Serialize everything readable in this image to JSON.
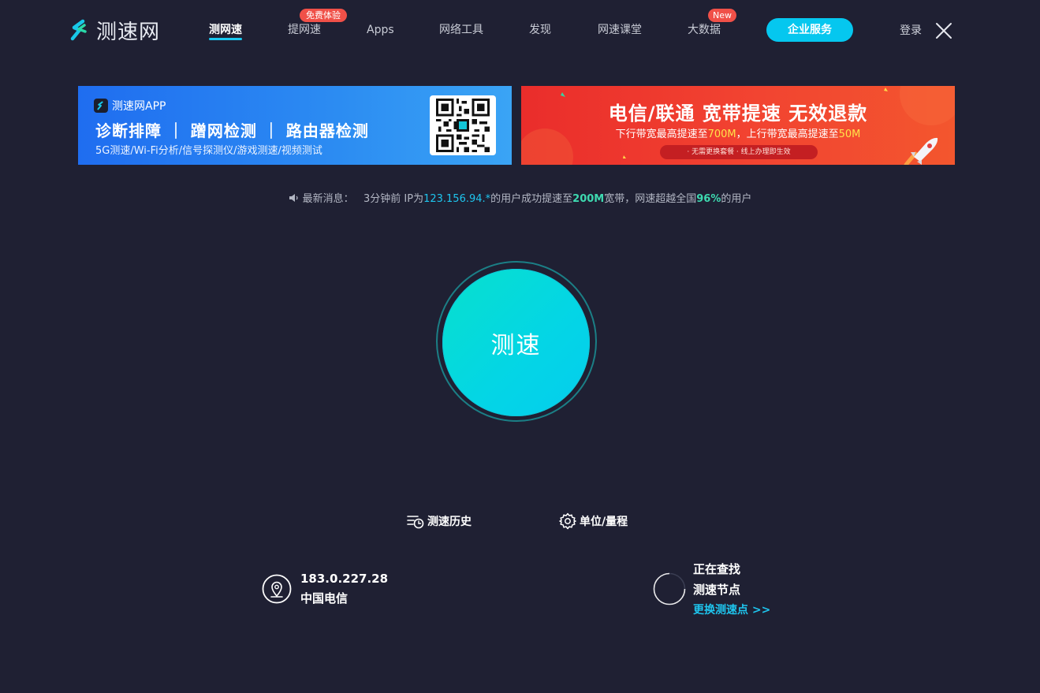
{
  "brand": {
    "name": "测速网",
    "logo_icon": "speedtest-logo-icon"
  },
  "nav": {
    "items": [
      {
        "label": "测网速",
        "active": true
      },
      {
        "label": "提网速",
        "badge": "免费体验"
      },
      {
        "label": "Apps"
      },
      {
        "label": "网络工具"
      },
      {
        "label": "发现"
      },
      {
        "label": "网速课堂"
      },
      {
        "label": "大数据",
        "badge": "New"
      }
    ],
    "enterprise_label": "企业服务",
    "login_label": "登录",
    "close_icon": "close-icon"
  },
  "banners": {
    "app": {
      "app_name": "测速网APP",
      "features": "诊断排障 ｜ 蹭网检测 ｜ 路由器检测",
      "subtitle": "5G测速/Wi-Fi分析/信号探测仪/游戏测速/视频测试",
      "qr_icon": "qr-code-icon"
    },
    "promo": {
      "title": "电信/联通 宽带提速 无效退款",
      "sub_prefix": "下行带宽最高提速至",
      "sub_down": "700M",
      "sub_mid": "，上行带宽最高提速至",
      "sub_up": "50M",
      "pill": "· 无需更换套餐    · 线上办理即生效",
      "rocket_icon": "rocket-icon"
    }
  },
  "news": {
    "label": "最新消息：",
    "time": "3分钟前 IP为",
    "ip": "123.156.94.*",
    "mid": "的用户成功提速至",
    "speed": "200M",
    "mid2": "宽带，网速超越全国",
    "percent": "96%",
    "suffix": "的用户"
  },
  "start": {
    "label": "测速"
  },
  "tools": {
    "history_label": "测速历史",
    "units_label": "单位/量程"
  },
  "client": {
    "ip": "183.0.227.28",
    "isp": "中国电信"
  },
  "server": {
    "status_line1": "正在查找",
    "status_line2": "测速节点",
    "change_link": "更换测速点 >>"
  },
  "colors": {
    "background": "#1f2033",
    "accent": "#05c7ef",
    "start_gradient_from": "#07e0cd",
    "start_gradient_to": "#05cdee",
    "badge_red": "#f05048",
    "highlight_green": "#3ed9b0"
  }
}
